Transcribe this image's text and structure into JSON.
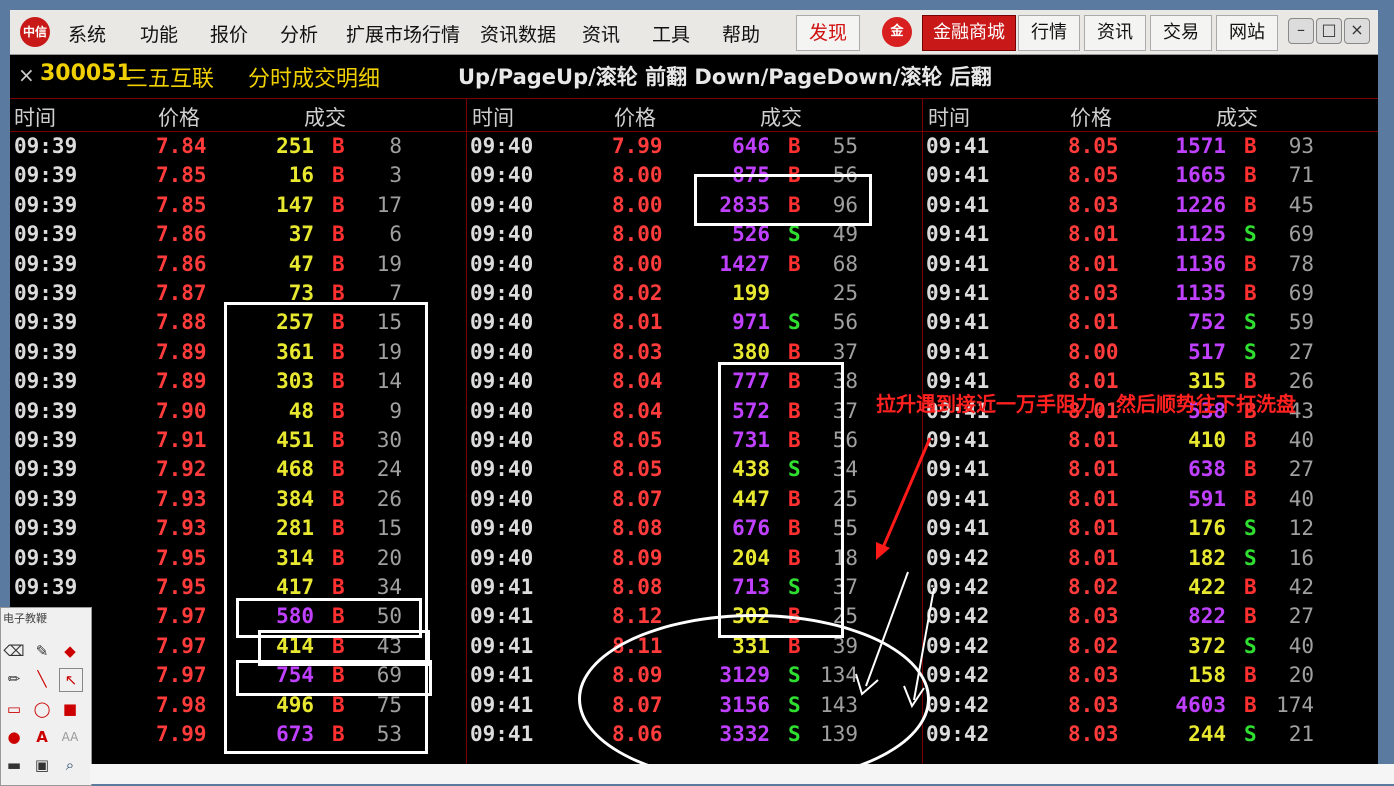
{
  "menu": {
    "logo": "中信",
    "items": [
      "系统",
      "功能",
      "报价",
      "分析",
      "扩展市场行情",
      "资讯数据",
      "资讯",
      "工具",
      "帮助"
    ],
    "discover": "发现",
    "mall": "金融商城",
    "buttons": [
      "行情",
      "资讯",
      "交易",
      "网站"
    ]
  },
  "title": {
    "close": "×",
    "code": "300051",
    "name": "三五互联",
    "detail": "分时成交明细",
    "hint": "Up/PageUp/滚轮 前翻 Down/PageDown/滚轮 后翻"
  },
  "headers": [
    "时间",
    "价格",
    "成交"
  ],
  "colors": {
    "price": "#ff3b3b",
    "buy": "#ff3030",
    "sell": "#30e030",
    "vol_small": "#e8e830",
    "vol_large": "#c040ff",
    "annotation": "#ff2020"
  },
  "columns": [
    [
      {
        "t": "09:39",
        "p": "7.84",
        "v": "251",
        "d": "B",
        "n": "8",
        "big": false
      },
      {
        "t": "09:39",
        "p": "7.85",
        "v": "16",
        "d": "B",
        "n": "3",
        "big": false
      },
      {
        "t": "09:39",
        "p": "7.85",
        "v": "147",
        "d": "B",
        "n": "17",
        "big": false
      },
      {
        "t": "09:39",
        "p": "7.86",
        "v": "37",
        "d": "B",
        "n": "6",
        "big": false
      },
      {
        "t": "09:39",
        "p": "7.86",
        "v": "47",
        "d": "B",
        "n": "19",
        "big": false
      },
      {
        "t": "09:39",
        "p": "7.87",
        "v": "73",
        "d": "B",
        "n": "7",
        "big": false
      },
      {
        "t": "09:39",
        "p": "7.88",
        "v": "257",
        "d": "B",
        "n": "15",
        "big": false
      },
      {
        "t": "09:39",
        "p": "7.89",
        "v": "361",
        "d": "B",
        "n": "19",
        "big": false
      },
      {
        "t": "09:39",
        "p": "7.89",
        "v": "303",
        "d": "B",
        "n": "14",
        "big": false
      },
      {
        "t": "09:39",
        "p": "7.90",
        "v": "48",
        "d": "B",
        "n": "9",
        "big": false
      },
      {
        "t": "09:39",
        "p": "7.91",
        "v": "451",
        "d": "B",
        "n": "30",
        "big": false
      },
      {
        "t": "09:39",
        "p": "7.92",
        "v": "468",
        "d": "B",
        "n": "24",
        "big": false
      },
      {
        "t": "09:39",
        "p": "7.93",
        "v": "384",
        "d": "B",
        "n": "26",
        "big": false
      },
      {
        "t": "09:39",
        "p": "7.93",
        "v": "281",
        "d": "B",
        "n": "15",
        "big": false
      },
      {
        "t": "09:39",
        "p": "7.95",
        "v": "314",
        "d": "B",
        "n": "20",
        "big": false
      },
      {
        "t": "09:39",
        "p": "7.95",
        "v": "417",
        "d": "B",
        "n": "34",
        "big": false
      },
      {
        "t": "09:39",
        "p": "7.97",
        "v": "580",
        "d": "B",
        "n": "50",
        "big": true
      },
      {
        "t": "09:39",
        "p": "7.97",
        "v": "414",
        "d": "B",
        "n": "43",
        "big": false
      },
      {
        "t": "09:39",
        "p": "7.97",
        "v": "754",
        "d": "B",
        "n": "69",
        "big": true
      },
      {
        "t": "09:39",
        "p": "7.98",
        "v": "496",
        "d": "B",
        "n": "75",
        "big": false
      },
      {
        "t": "09:39",
        "p": "7.99",
        "v": "673",
        "d": "B",
        "n": "53",
        "big": true
      }
    ],
    [
      {
        "t": "09:40",
        "p": "7.99",
        "v": "646",
        "d": "B",
        "n": "55",
        "big": true
      },
      {
        "t": "09:40",
        "p": "8.00",
        "v": "875",
        "d": "B",
        "n": "56",
        "big": true
      },
      {
        "t": "09:40",
        "p": "8.00",
        "v": "2835",
        "d": "B",
        "n": "96",
        "big": true
      },
      {
        "t": "09:40",
        "p": "8.00",
        "v": "526",
        "d": "S",
        "n": "49",
        "big": true
      },
      {
        "t": "09:40",
        "p": "8.00",
        "v": "1427",
        "d": "B",
        "n": "68",
        "big": true
      },
      {
        "t": "09:40",
        "p": "8.02",
        "v": "199",
        "d": "",
        "n": "25",
        "big": false
      },
      {
        "t": "09:40",
        "p": "8.01",
        "v": "971",
        "d": "S",
        "n": "56",
        "big": true
      },
      {
        "t": "09:40",
        "p": "8.03",
        "v": "380",
        "d": "B",
        "n": "37",
        "big": false
      },
      {
        "t": "09:40",
        "p": "8.04",
        "v": "777",
        "d": "B",
        "n": "38",
        "big": true
      },
      {
        "t": "09:40",
        "p": "8.04",
        "v": "572",
        "d": "B",
        "n": "37",
        "big": true
      },
      {
        "t": "09:40",
        "p": "8.05",
        "v": "731",
        "d": "B",
        "n": "56",
        "big": true
      },
      {
        "t": "09:40",
        "p": "8.05",
        "v": "438",
        "d": "S",
        "n": "34",
        "big": false
      },
      {
        "t": "09:40",
        "p": "8.07",
        "v": "447",
        "d": "B",
        "n": "25",
        "big": false
      },
      {
        "t": "09:40",
        "p": "8.08",
        "v": "676",
        "d": "B",
        "n": "55",
        "big": true
      },
      {
        "t": "09:40",
        "p": "8.09",
        "v": "204",
        "d": "B",
        "n": "18",
        "big": false
      },
      {
        "t": "09:41",
        "p": "8.08",
        "v": "713",
        "d": "S",
        "n": "37",
        "big": true
      },
      {
        "t": "09:41",
        "p": "8.12",
        "v": "302",
        "d": "B",
        "n": "25",
        "big": false
      },
      {
        "t": "09:41",
        "p": "8.11",
        "v": "331",
        "d": "B",
        "n": "39",
        "big": false
      },
      {
        "t": "09:41",
        "p": "8.09",
        "v": "3129",
        "d": "S",
        "n": "134",
        "big": true
      },
      {
        "t": "09:41",
        "p": "8.07",
        "v": "3156",
        "d": "S",
        "n": "143",
        "big": true
      },
      {
        "t": "09:41",
        "p": "8.06",
        "v": "3332",
        "d": "S",
        "n": "139",
        "big": true
      }
    ],
    [
      {
        "t": "09:41",
        "p": "8.05",
        "v": "1571",
        "d": "B",
        "n": "93",
        "big": true
      },
      {
        "t": "09:41",
        "p": "8.05",
        "v": "1665",
        "d": "B",
        "n": "71",
        "big": true
      },
      {
        "t": "09:41",
        "p": "8.03",
        "v": "1226",
        "d": "B",
        "n": "45",
        "big": true
      },
      {
        "t": "09:41",
        "p": "8.01",
        "v": "1125",
        "d": "S",
        "n": "69",
        "big": true
      },
      {
        "t": "09:41",
        "p": "8.01",
        "v": "1136",
        "d": "B",
        "n": "78",
        "big": true
      },
      {
        "t": "09:41",
        "p": "8.03",
        "v": "1135",
        "d": "B",
        "n": "69",
        "big": true
      },
      {
        "t": "09:41",
        "p": "8.01",
        "v": "752",
        "d": "S",
        "n": "59",
        "big": true
      },
      {
        "t": "09:41",
        "p": "8.00",
        "v": "517",
        "d": "S",
        "n": "27",
        "big": true
      },
      {
        "t": "09:41",
        "p": "8.01",
        "v": "315",
        "d": "B",
        "n": "26",
        "big": false
      },
      {
        "t": "09:41",
        "p": "8.01",
        "v": "538",
        "d": "B",
        "n": "43",
        "big": true
      },
      {
        "t": "09:41",
        "p": "8.01",
        "v": "410",
        "d": "B",
        "n": "40",
        "big": false
      },
      {
        "t": "09:41",
        "p": "8.01",
        "v": "638",
        "d": "B",
        "n": "27",
        "big": true
      },
      {
        "t": "09:41",
        "p": "8.01",
        "v": "591",
        "d": "B",
        "n": "40",
        "big": true
      },
      {
        "t": "09:41",
        "p": "8.01",
        "v": "176",
        "d": "S",
        "n": "12",
        "big": false
      },
      {
        "t": "09:42",
        "p": "8.01",
        "v": "182",
        "d": "S",
        "n": "16",
        "big": false
      },
      {
        "t": "09:42",
        "p": "8.02",
        "v": "422",
        "d": "B",
        "n": "42",
        "big": false
      },
      {
        "t": "09:42",
        "p": "8.03",
        "v": "822",
        "d": "B",
        "n": "27",
        "big": true
      },
      {
        "t": "09:42",
        "p": "8.02",
        "v": "372",
        "d": "S",
        "n": "40",
        "big": false
      },
      {
        "t": "09:42",
        "p": "8.03",
        "v": "158",
        "d": "B",
        "n": "20",
        "big": false
      },
      {
        "t": "09:42",
        "p": "8.03",
        "v": "4603",
        "d": "B",
        "n": "174",
        "big": true
      },
      {
        "t": "09:42",
        "p": "8.03",
        "v": "244",
        "d": "S",
        "n": "21",
        "big": false
      }
    ]
  ],
  "annotation": "拉升遇到接近一万手阻力，然后顺势往下打洗盘",
  "toolbox": {
    "title": "电子教鞭"
  }
}
